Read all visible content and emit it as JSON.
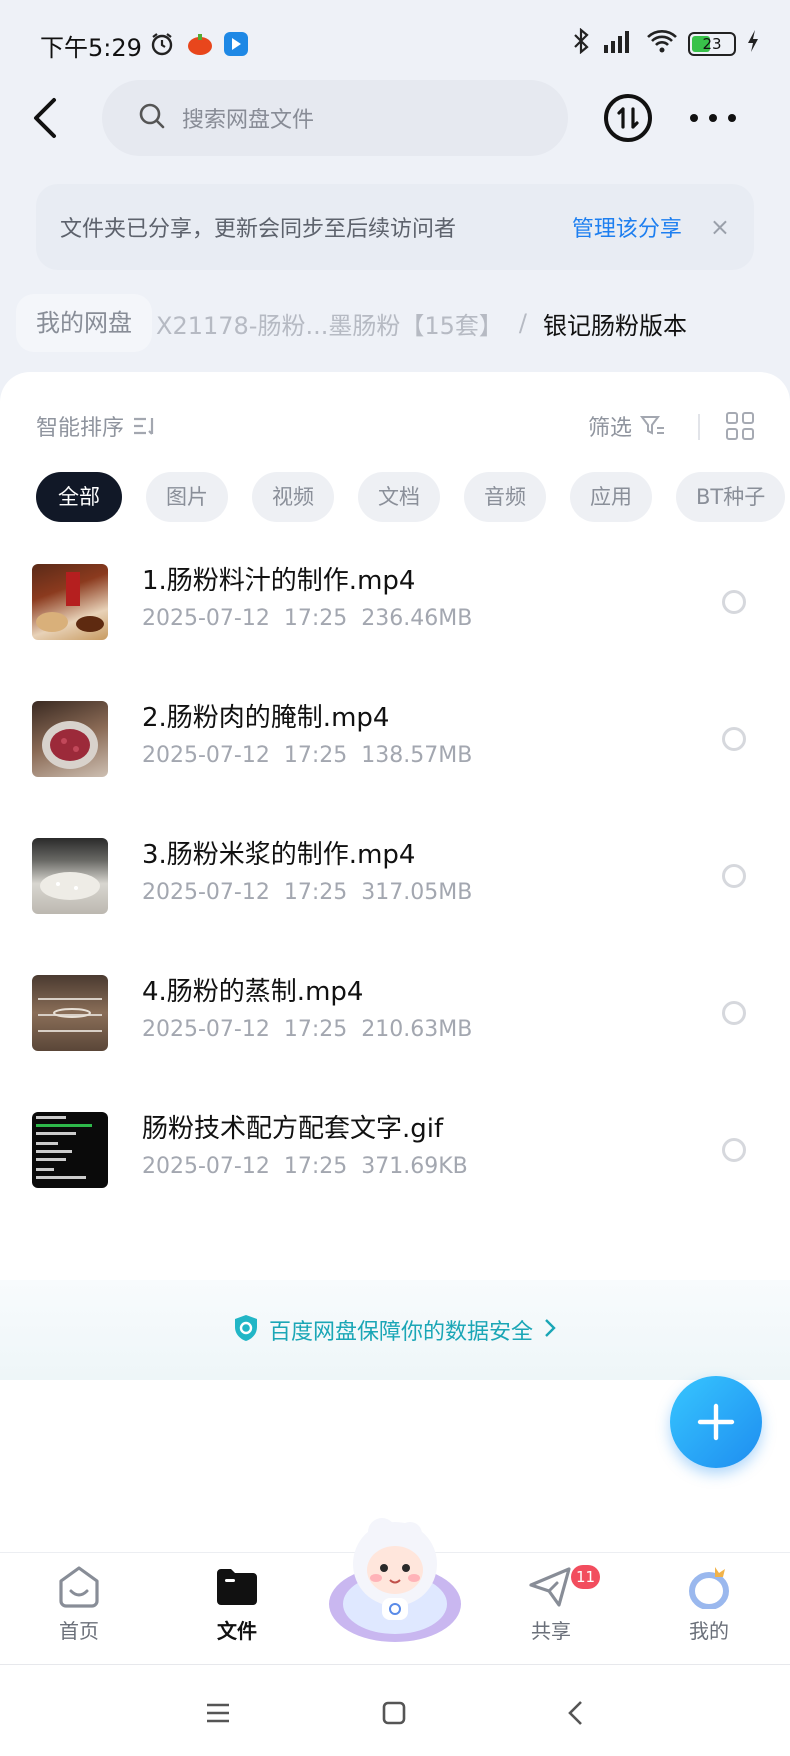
{
  "status_bar": {
    "time": "下午5:29",
    "battery": "23"
  },
  "header": {
    "search_placeholder": "搜索网盘文件"
  },
  "notice": {
    "text": "文件夹已分享，更新会同步至后续访问者",
    "link": "管理该分享",
    "close": "×"
  },
  "breadcrumb": {
    "root": "我的网盘",
    "middle": "X21178-肠粉...墨肠粉【15套】",
    "separator": "/",
    "current": "银记肠粉版本"
  },
  "toolbar": {
    "sort_label": "智能排序",
    "filter_label": "筛选"
  },
  "filter_chips": [
    "全部",
    "图片",
    "视频",
    "文档",
    "音频",
    "应用",
    "BT种子"
  ],
  "files": [
    {
      "name": "1.肠粉料汁的制作.mp4",
      "date": "2025-07-12",
      "time": "17:25",
      "size": "236.46MB"
    },
    {
      "name": "2.肠粉肉的腌制.mp4",
      "date": "2025-07-12",
      "time": "17:25",
      "size": "138.57MB"
    },
    {
      "name": "3.肠粉米浆的制作.mp4",
      "date": "2025-07-12",
      "time": "17:25",
      "size": "317.05MB"
    },
    {
      "name": "4.肠粉的蒸制.mp4",
      "date": "2025-07-12",
      "time": "17:25",
      "size": "210.63MB"
    },
    {
      "name": "肠粉技术配方配套文字.gif",
      "date": "2025-07-12",
      "time": "17:25",
      "size": "371.69KB"
    }
  ],
  "safety": {
    "text": "百度网盘保障你的数据安全"
  },
  "bottom_nav": {
    "home": "首页",
    "files": "文件",
    "share": "共享",
    "share_badge": "11",
    "mine": "我的"
  },
  "colors": {
    "accent": "#1e7ff0",
    "safety": "#1aa6b6",
    "fab": "#2196f3",
    "badge": "#f24d5e"
  }
}
